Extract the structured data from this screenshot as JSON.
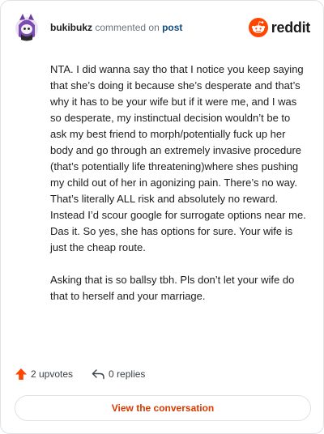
{
  "header": {
    "username": "bukibukz",
    "action_text": "commented on",
    "post_link": "post",
    "logo_text": "reddit"
  },
  "comment": {
    "paragraphs": [
      "NTA. I did wanna say tho that I notice you keep saying that she’s doing it because she’s desperate and that’s why it has to be your wife but if it were me, and I was so desperate, my instinctual decision wouldn’t be to ask my best friend to morph/potentially fuck up her body and go through an extremely invasive procedure (that’s potentially life threatening)where shes pushing my child out of her in agonizing pain. There’s no way. That’s literally ALL risk and absolutely no reward. Instead I’d scour google for surrogate options near me. Das it. So yes, she has options for sure. Your wife is just the cheap route.",
      "Asking that is so ballsy tbh. Pls don’t let your wife do that to herself and your marriage."
    ]
  },
  "stats": {
    "upvotes": "2 upvotes",
    "replies": "0 replies"
  },
  "footer": {
    "view_button": "View the conversation"
  },
  "colors": {
    "reddit_orange": "#ff4500",
    "upvote": "#ff4500",
    "link_blue": "#0f4c81",
    "button_text": "#d93a00"
  },
  "icons": {
    "avatar": "purple-snoo-avatar",
    "logo": "reddit-snoo-icon",
    "upvote": "upvote-arrow-icon",
    "reply": "reply-arrow-icon"
  }
}
